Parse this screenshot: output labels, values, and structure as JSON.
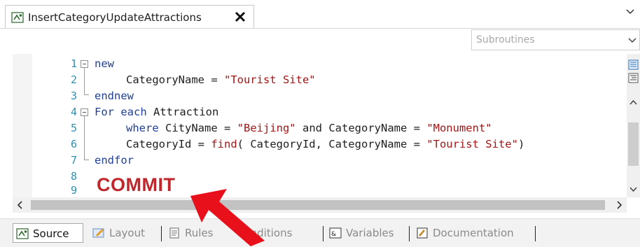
{
  "document_tab": {
    "title": "InsertCategoryUpdateAttractions"
  },
  "toolbar": {
    "subroutines_placeholder": "Subroutines"
  },
  "code": {
    "line_numbers": [
      "1",
      "2",
      "3",
      "4",
      "5",
      "6",
      "7",
      "8",
      "9"
    ],
    "line1_kw": "new",
    "line2_a": "CategoryName = ",
    "line2_str": "\"Tourist Site\"",
    "line3_kw": "endnew",
    "line4_a": "For each ",
    "line4_b": "Attraction",
    "line5_kw": "where ",
    "line5_a": "CityName = ",
    "line5_str1": "\"Beijing\"",
    "line5_and": " and ",
    "line5_b": "CategoryName = ",
    "line5_str2": "\"Monument\"",
    "line6_a": "CategoryId = ",
    "line6_fn": "find",
    "line6_b": "( CategoryId, CategoryName = ",
    "line6_str": "\"Tourist Site\"",
    "line6_c": ")",
    "line7_kw": "endfor",
    "commit": "COMMIT"
  },
  "bottom_tabs": [
    "Source",
    "Layout",
    "Rules",
    "Conditions",
    "Variables",
    "Documentation"
  ],
  "colors": {
    "keyword": "#1f3f9a",
    "string": "#a31515",
    "line_number": "#2b91af",
    "commit": "#c0272d",
    "arrow": "#e8101a"
  }
}
